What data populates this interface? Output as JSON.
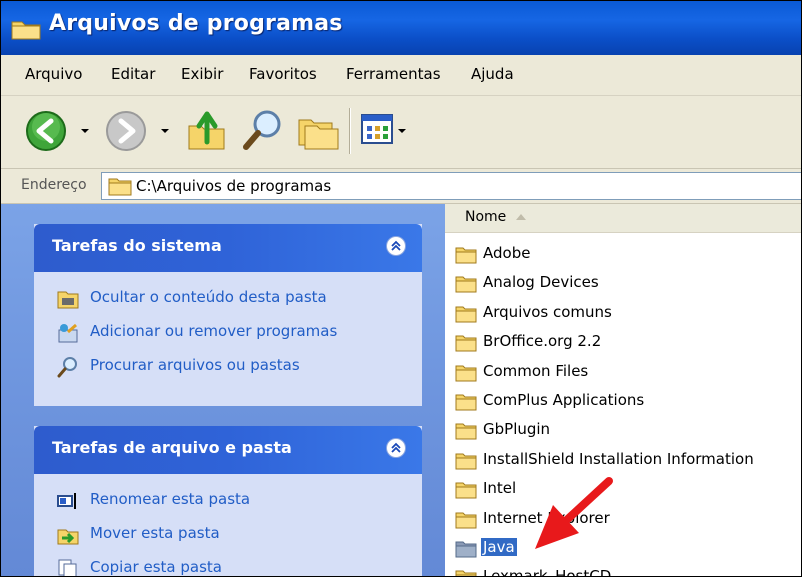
{
  "window": {
    "title": "Arquivos de programas"
  },
  "menu": {
    "items": [
      "Arquivo",
      "Editar",
      "Exibir",
      "Favoritos",
      "Ferramentas",
      "Ajuda"
    ]
  },
  "toolbar": {
    "buttons": [
      {
        "icon": "back-arrow-icon"
      },
      {
        "icon": "forward-arrow-icon"
      },
      {
        "icon": "up-folder-icon"
      },
      {
        "icon": "search-magnifier-icon"
      },
      {
        "icon": "folders-icon"
      },
      {
        "icon": "views-icon"
      }
    ]
  },
  "address": {
    "label": "Endereço",
    "value": "C:\\Arquivos de programas"
  },
  "tasks_panel": {
    "title": "Tarefas do sistema",
    "items": [
      {
        "label": "Ocultar o conteúdo desta pasta",
        "icon": "hide-contents-icon"
      },
      {
        "label": "Adicionar ou remover programas",
        "icon": "add-remove-programs-icon"
      },
      {
        "label": "Procurar arquivos ou pastas",
        "icon": "search-icon"
      }
    ]
  },
  "file_tasks_panel": {
    "title": "Tarefas de arquivo e pasta",
    "items": [
      {
        "label": "Renomear esta pasta",
        "icon": "rename-icon"
      },
      {
        "label": "Mover esta pasta",
        "icon": "move-icon"
      },
      {
        "label": "Copiar esta pasta",
        "icon": "copy-icon"
      }
    ]
  },
  "file_list": {
    "column": "Nome",
    "items": [
      {
        "name": "Adobe",
        "selected": false
      },
      {
        "name": "Analog Devices",
        "selected": false
      },
      {
        "name": "Arquivos comuns",
        "selected": false
      },
      {
        "name": "BrOffice.org 2.2",
        "selected": false
      },
      {
        "name": "Common Files",
        "selected": false
      },
      {
        "name": "ComPlus Applications",
        "selected": false
      },
      {
        "name": "GbPlugin",
        "selected": false
      },
      {
        "name": "InstallShield Installation Information",
        "selected": false
      },
      {
        "name": "Intel",
        "selected": false
      },
      {
        "name": "Internet Explorer",
        "selected": false
      },
      {
        "name": "Java",
        "selected": true
      },
      {
        "name": "Lexmark_HostCD",
        "selected": false
      }
    ]
  },
  "colors": {
    "title_bar": "#0a5ad6",
    "task_panel_bg": "#d6dff7",
    "left_pane_bg": "#6e95de",
    "selection": "#316ac5",
    "task_link": "#215dc6",
    "annotation_arrow": "#e8191b"
  }
}
